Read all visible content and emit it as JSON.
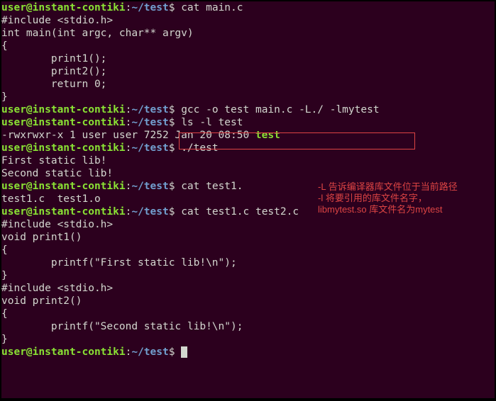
{
  "prompt": {
    "user": "user@instant-contiki",
    "sep": ":",
    "path": "~/test",
    "symbol": "$"
  },
  "lines": {
    "l1_cmd": "cat main.c",
    "l2": "#include <stdio.h>",
    "l3": "",
    "l4": "int main(int argc, char** argv)",
    "l5": "{",
    "l6": "        print1();",
    "l7": "        print2();",
    "l8": "        return 0;",
    "l9": "}",
    "l10_cmd": "gcc -o test main.c -L./ -lmytest",
    "l11_cmd": "ls -l test",
    "l12a": "-rwxrwxr-x 1 user user 7252 Jan 20 08:50 ",
    "l12b": "test",
    "l13_cmd": "./test",
    "l14": "First static lib!",
    "l15": "Second static lib!",
    "l16_cmd": "cat test1.",
    "l17": "test1.c  test1.o  ",
    "l18_cmd": "cat test1.c test2.c",
    "l19": "#include <stdio.h>",
    "l20": "void print1()",
    "l21": "{",
    "l22": "        printf(\"First static lib!\\n\");",
    "l23": "",
    "l24": "}",
    "l25": "#include <stdio.h>",
    "l26": "",
    "l27": "void print2()",
    "l28": "{",
    "l29": "        printf(\"Second static lib!\\n\");",
    "l30": "}",
    "l31_cmd": ""
  },
  "annotation": {
    "line1": "-L 告诉编译器库文件位于当前路径",
    "line2": "-l 将要引用的库文件名字，",
    "line3": "libmytest.so 库文件名为mytest"
  }
}
